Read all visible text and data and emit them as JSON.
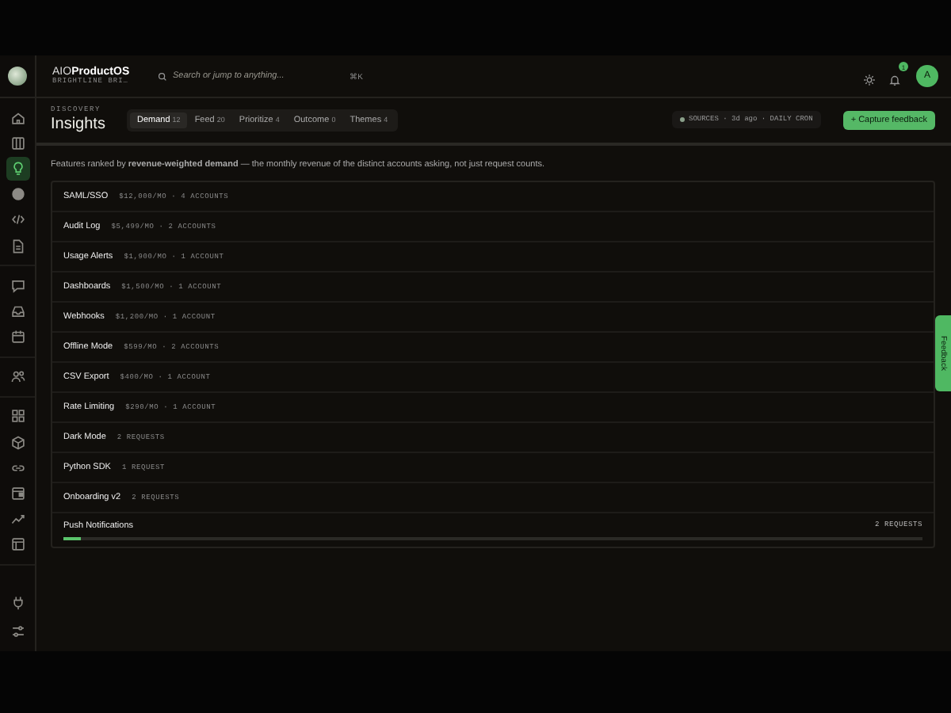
{
  "brand": {
    "name_plain": "AIO",
    "name_accent": "ProductOS",
    "workspace": "BRIGHTLINE BRI…"
  },
  "search": {
    "placeholder": "Search or jump to anything...",
    "shortcut": "⌘K"
  },
  "notifications": {
    "badge": "1"
  },
  "avatar": {
    "initial": "A"
  },
  "sidebar": {
    "items": [
      {
        "kind": "home",
        "selected": false
      },
      {
        "kind": "columns",
        "selected": false
      },
      {
        "kind": "bulb",
        "selected": true
      },
      {
        "kind": "globe",
        "selected": false
      },
      {
        "kind": "code",
        "selected": false
      },
      {
        "kind": "doc",
        "selected": false
      },
      {
        "kind": "chat",
        "selected": false
      },
      {
        "kind": "inbox",
        "selected": false
      },
      {
        "kind": "calendar",
        "selected": false
      },
      {
        "kind": "users",
        "selected": false
      },
      {
        "kind": "grid",
        "selected": false
      },
      {
        "kind": "cube",
        "selected": false
      },
      {
        "kind": "link",
        "selected": false
      },
      {
        "kind": "window",
        "selected": false
      },
      {
        "kind": "trend",
        "selected": false
      },
      {
        "kind": "layout",
        "selected": false
      }
    ],
    "footer": [
      {
        "kind": "plug"
      },
      {
        "kind": "sliders"
      }
    ]
  },
  "header": {
    "eyebrow": "DISCOVERY",
    "title": "Insights"
  },
  "tabs": [
    {
      "label": "Demand",
      "count": "12",
      "selected": true
    },
    {
      "label": "Feed",
      "count": "20",
      "selected": false
    },
    {
      "label": "Prioritize",
      "count": "4",
      "selected": false
    },
    {
      "label": "Outcome",
      "count": "0",
      "selected": false
    },
    {
      "label": "Themes",
      "count": "4",
      "selected": false
    }
  ],
  "sources": {
    "text": "SOURCES · 3d ago · DAILY CRON"
  },
  "capture_button": "+ Capture feedback",
  "description": "Features ranked by **revenue-weighted demand** — the monthly revenue of the distinct accounts asking, not just request counts.",
  "features": [
    {
      "name": "SAML/SSO",
      "meta": "$12,000/MO · 4 ACCOUNTS"
    },
    {
      "name": "Audit Log",
      "meta": "$5,499/MO · 2 ACCOUNTS"
    },
    {
      "name": "Usage Alerts",
      "meta": "$1,900/MO · 1 ACCOUNT"
    },
    {
      "name": "Dashboards",
      "meta": "$1,500/MO · 1 ACCOUNT"
    },
    {
      "name": "Webhooks",
      "meta": "$1,200/MO · 1 ACCOUNT"
    },
    {
      "name": "Offline Mode",
      "meta": "$599/MO · 2 ACCOUNTS"
    },
    {
      "name": "CSV Export",
      "meta": "$400/MO · 1 ACCOUNT"
    },
    {
      "name": "Rate Limiting",
      "meta": "$290/MO · 1 ACCOUNT"
    },
    {
      "name": "Dark Mode",
      "meta": "2 REQUESTS"
    },
    {
      "name": "Python SDK",
      "meta": "1 REQUEST"
    },
    {
      "name": "Onboarding v2",
      "meta": "2 REQUESTS"
    },
    {
      "name": "Push Notifications",
      "right": "2 REQUESTS",
      "level": 0.02
    }
  ],
  "feedback_tab": "Feedback"
}
